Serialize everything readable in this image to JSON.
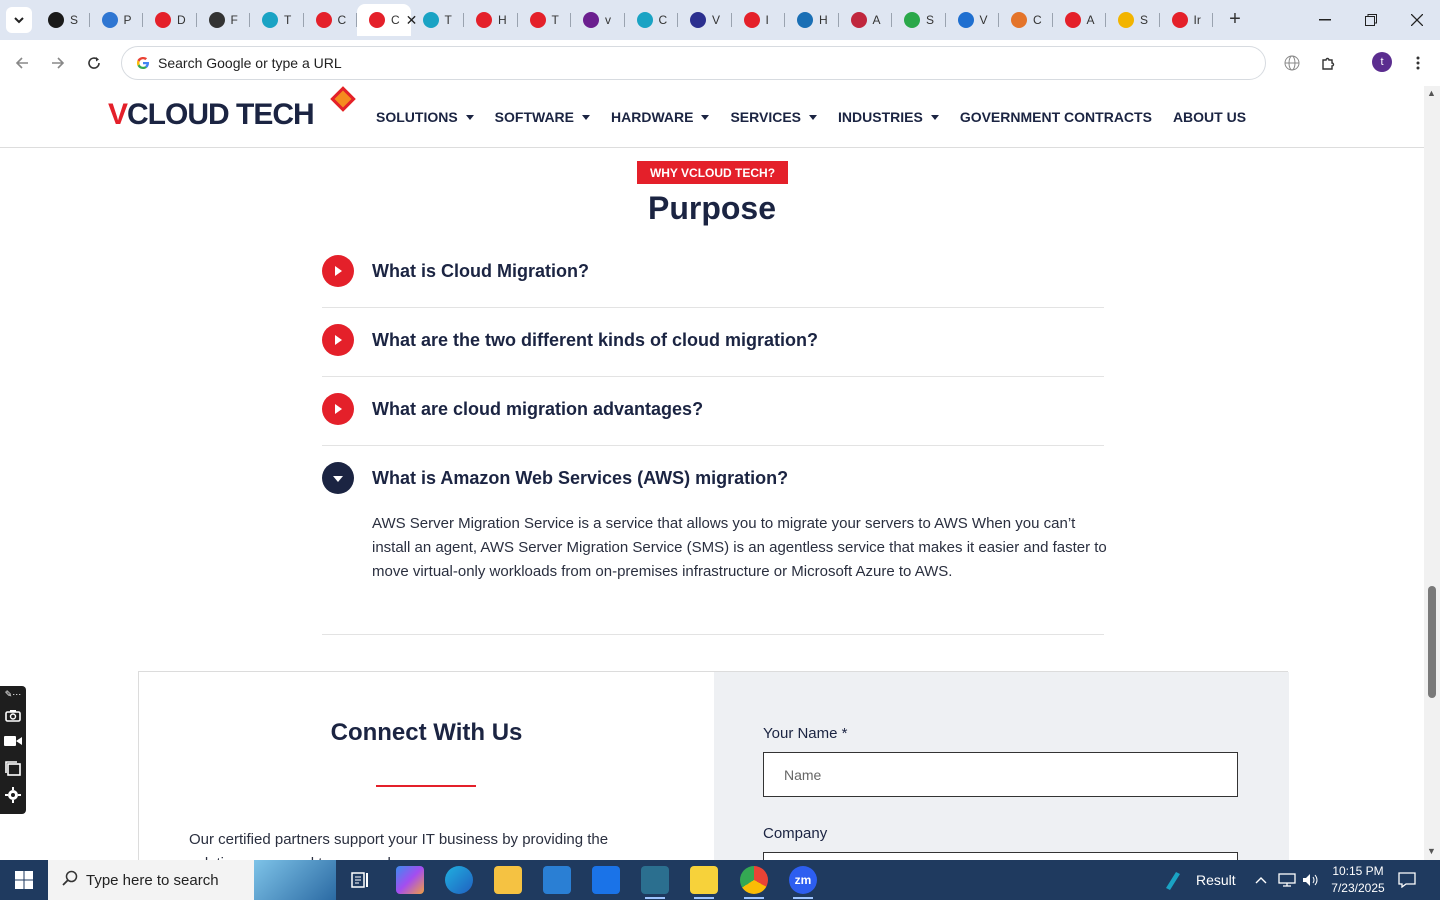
{
  "browser": {
    "tabs": [
      {
        "title": "S",
        "color": "#1a1a1a"
      },
      {
        "title": "P",
        "color": "#2f76d2"
      },
      {
        "title": "D",
        "color": "#e4202a"
      },
      {
        "title": "F",
        "color": "#333333"
      },
      {
        "title": "T",
        "color": "#1aa3c4"
      },
      {
        "title": "C",
        "color": "#e4202a"
      },
      {
        "title": "C",
        "color": "#e4202a",
        "active": true
      },
      {
        "title": "T",
        "color": "#1aa3c4"
      },
      {
        "title": "H",
        "color": "#e4202a"
      },
      {
        "title": "T",
        "color": "#e4202a"
      },
      {
        "title": "v",
        "color": "#6b1f8f"
      },
      {
        "title": "C",
        "color": "#1aa3c4"
      },
      {
        "title": "V",
        "color": "#2b2f8f"
      },
      {
        "title": "I",
        "color": "#e4202a"
      },
      {
        "title": "H",
        "color": "#1a6fb5"
      },
      {
        "title": "A",
        "color": "#c0263d"
      },
      {
        "title": "S",
        "color": "#2aa84a"
      },
      {
        "title": "V",
        "color": "#1f6fd0"
      },
      {
        "title": "C",
        "color": "#e4742a"
      },
      {
        "title": "A",
        "color": "#e4202a"
      },
      {
        "title": "S",
        "color": "#f2b400"
      },
      {
        "title": "Ir",
        "color": "#e4202a"
      }
    ],
    "omnibox_placeholder": "Search Google or type a URL",
    "profile_initial": "t"
  },
  "site": {
    "logo": {
      "part1": "V",
      "part2": "CLOUD TECH"
    },
    "nav": [
      {
        "label": "SOLUTIONS",
        "dropdown": true
      },
      {
        "label": "SOFTWARE",
        "dropdown": true
      },
      {
        "label": "HARDWARE",
        "dropdown": true
      },
      {
        "label": "SERVICES",
        "dropdown": true
      },
      {
        "label": "INDUSTRIES",
        "dropdown": true
      },
      {
        "label": "GOVERNMENT CONTRACTS",
        "dropdown": false
      },
      {
        "label": "ABOUT US",
        "dropdown": false
      }
    ],
    "badge": "WHY VCLOUD TECH?",
    "title": "Purpose",
    "faq": [
      {
        "question": "What is Cloud Migration?",
        "open": false
      },
      {
        "question": "What are the two different kinds of cloud migration?",
        "open": false
      },
      {
        "question": "What are cloud migration advantages?",
        "open": false
      },
      {
        "question": "What is Amazon Web Services (AWS) migration?",
        "open": true,
        "answer": "AWS Server Migration Service is a service that allows you to migrate your servers to AWS When you can’t install an agent, AWS Server Migration Service (SMS) is an agentless service that makes it easier and faster to move virtual-only workloads from on-premises infrastructure or Microsoft Azure to AWS."
      }
    ],
    "connect": {
      "title": "Connect With Us",
      "text": "Our certified partners support your IT business by providing the solutions you need to succeed.",
      "name_label": "Your Name *",
      "name_placeholder": "Name",
      "company_label": "Company"
    }
  },
  "taskbar": {
    "search_placeholder": "Type here to search",
    "weather_label": "Result",
    "time": "10:15 PM",
    "date": "7/23/2025"
  },
  "colors": {
    "brand_red": "#e4202a",
    "brand_navy": "#1b2442"
  }
}
